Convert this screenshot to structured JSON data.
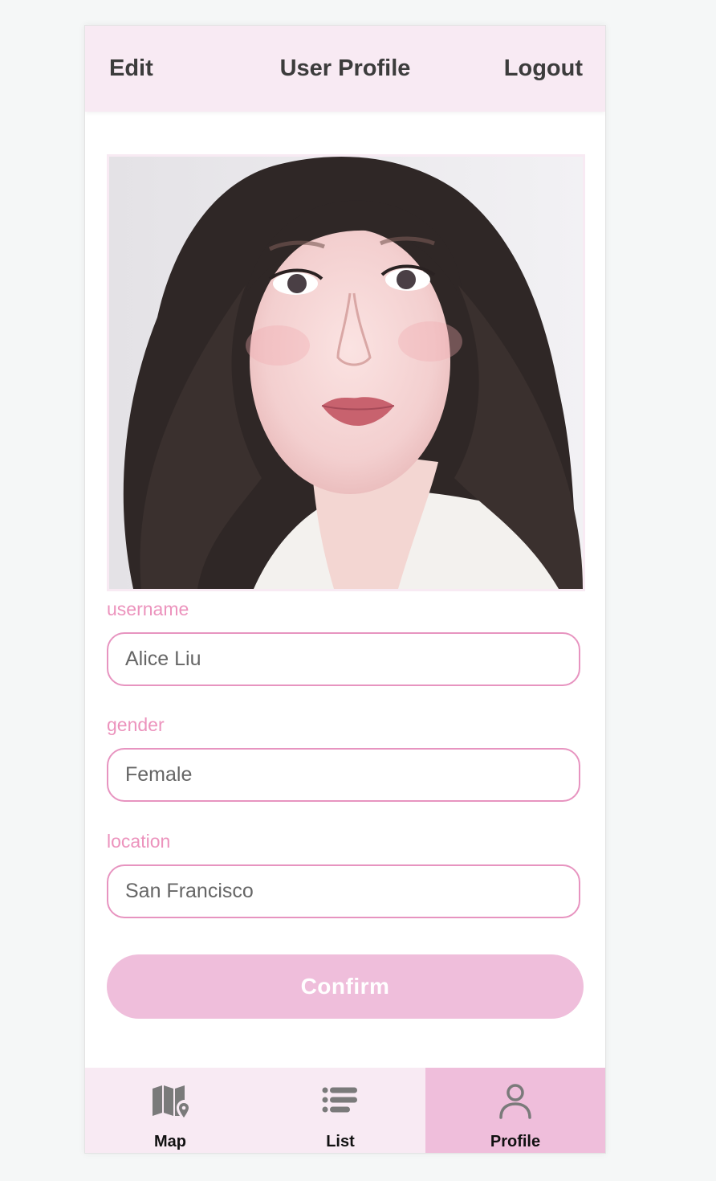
{
  "header": {
    "left_button": "Edit",
    "title": "User Profile",
    "right_button": "Logout"
  },
  "profile_photo": {
    "icon": "profile-photo"
  },
  "form": {
    "username": {
      "label": "username",
      "value": "Alice Liu"
    },
    "gender": {
      "label": "gender",
      "value": "Female"
    },
    "location": {
      "label": "location",
      "value": "San Francisco"
    },
    "confirm_label": "Confirm"
  },
  "tabbar": {
    "tabs": [
      {
        "label": "Map",
        "icon": "map-pin-icon",
        "active": false
      },
      {
        "label": "List",
        "icon": "list-icon",
        "active": false
      },
      {
        "label": "Profile",
        "icon": "user-icon",
        "active": true
      }
    ]
  },
  "colors": {
    "header_bg": "#f8eaf3",
    "accent_pink": "#e794c0",
    "label_pink": "#ec93bd",
    "button_pink": "#efbedb",
    "text_dark": "#3c3c3c",
    "icon_gray": "#7a7a7a"
  }
}
